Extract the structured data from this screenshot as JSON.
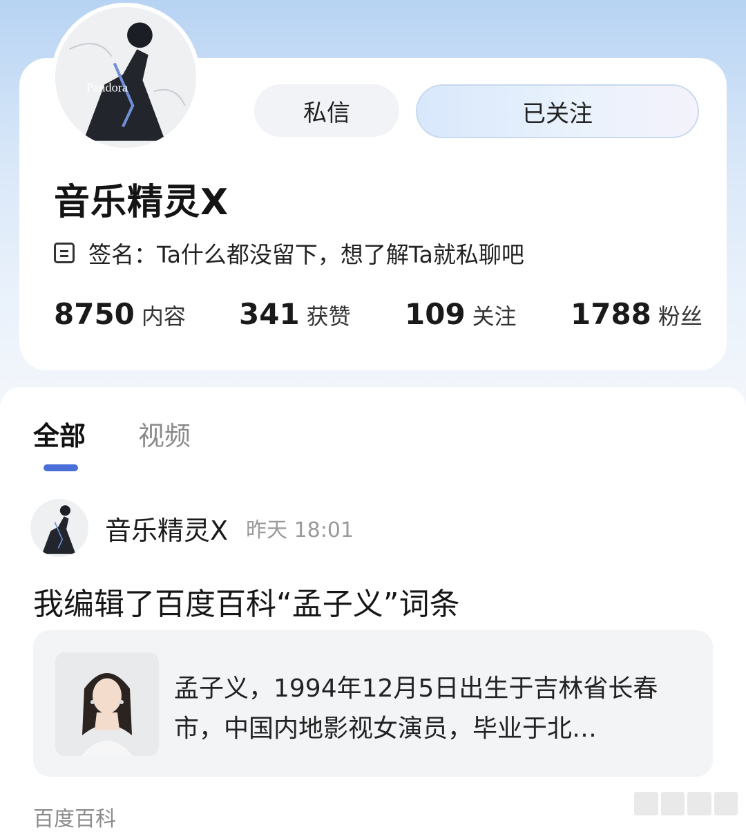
{
  "profile": {
    "avatar_text": "Pandora",
    "dm_button": "私信",
    "follow_button": "已关注",
    "username": "音乐精灵X",
    "signature": "签名：Ta什么都没留下，想了解Ta就私聊吧",
    "stats": [
      {
        "num": "8750",
        "label": "内容"
      },
      {
        "num": "341",
        "label": "获赞"
      },
      {
        "num": "109",
        "label": "关注"
      },
      {
        "num": "1788",
        "label": "粉丝"
      }
    ]
  },
  "tabs": {
    "all": "全部",
    "video": "视频"
  },
  "post": {
    "author": "音乐精灵X",
    "time": "昨天 18:01",
    "title": "我编辑了百度百科“孟子义”词条",
    "link_text": "孟子义，1994年12月5日出生于吉林省长春市，中国内地影视女演员，毕业于北…",
    "source": "百度百科"
  },
  "colors": {
    "accent": "#4a6fd8",
    "background_gradient_top": "#b7d3f3"
  }
}
